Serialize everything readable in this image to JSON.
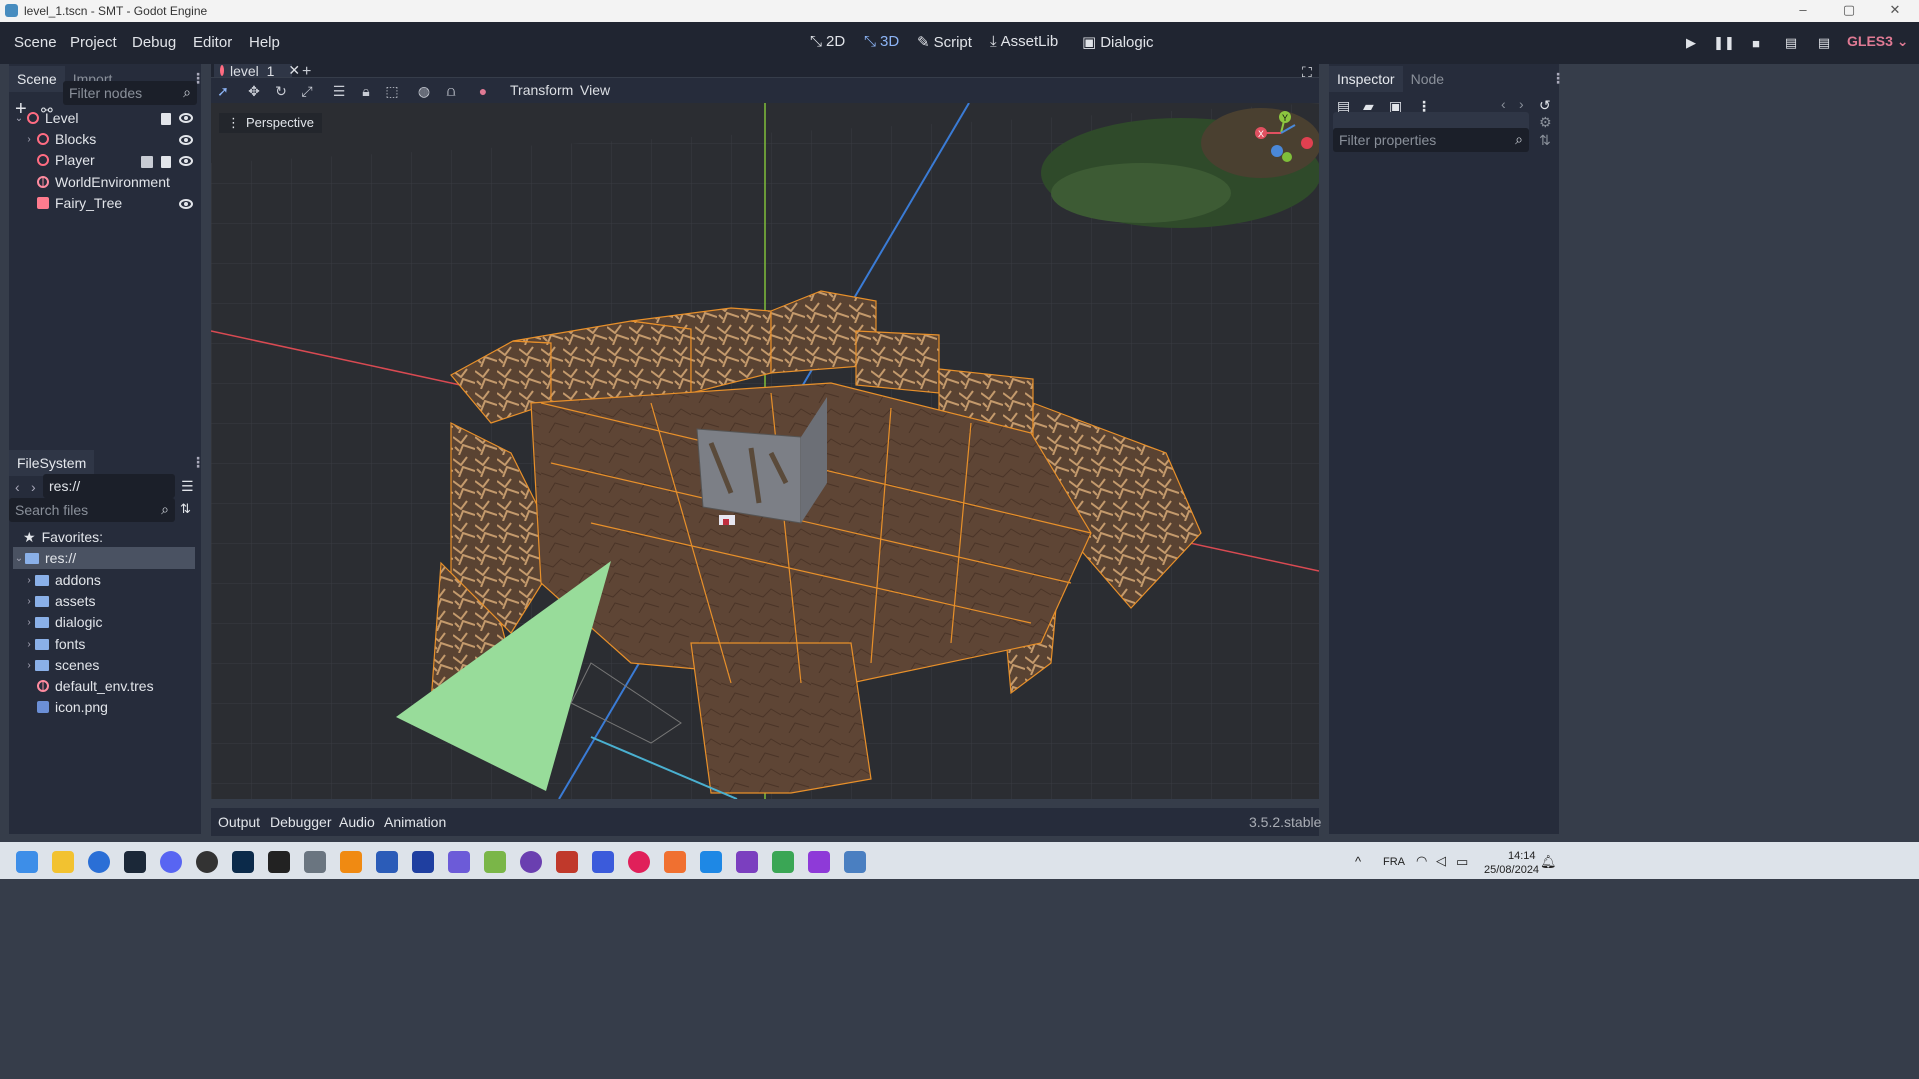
{
  "window": {
    "title": "level_1.tscn - SMT - Godot Engine",
    "minimize": "–",
    "maximize": "▢",
    "close": "✕"
  },
  "menu": {
    "scene": "Scene",
    "project": "Project",
    "debug": "Debug",
    "editor": "Editor",
    "help": "Help"
  },
  "workspaces": {
    "w2d": "2D",
    "w3d": "3D",
    "script": "Script",
    "assetlib": "AssetLib",
    "dialogic": "Dialogic"
  },
  "renderer": "GLES3",
  "scene_dock": {
    "tabs": [
      "Scene",
      "Import"
    ],
    "filter_placeholder": "Filter nodes",
    "nodes": [
      "Level",
      "Blocks",
      "Player",
      "WorldEnvironment",
      "Fairy_Tree"
    ]
  },
  "filesystem": {
    "tab": "FileSystem",
    "path": "res://",
    "search_placeholder": "Search files",
    "favorites": "Favorites:",
    "root": "res://",
    "folders": [
      "addons",
      "assets",
      "dialogic",
      "fonts",
      "scenes"
    ],
    "files": [
      "default_env.tres",
      "icon.png"
    ]
  },
  "editor_tab": {
    "name": "level_1",
    "close": "✕",
    "add": "+"
  },
  "viewport_toolbar": {
    "transform": "Transform",
    "view": "View"
  },
  "viewport": {
    "perspective": "Perspective",
    "gizmo_axes": [
      "X",
      "Y",
      "Z"
    ]
  },
  "inspector": {
    "tabs": [
      "Inspector",
      "Node"
    ],
    "filter_placeholder": "Filter properties"
  },
  "bottom_panel": {
    "tabs": [
      "Output",
      "Debugger",
      "Audio",
      "Animation"
    ],
    "version": "3.5.2.stable"
  },
  "taskbar": {
    "lang": "FRA",
    "time": "14:14",
    "date": "25/08/2024"
  },
  "colors": {
    "accent": "#8cb4f5",
    "node_red": "#ff6c82",
    "bg_dark": "#202531",
    "panel": "#262c3b",
    "wireframe": "#e8902a"
  }
}
